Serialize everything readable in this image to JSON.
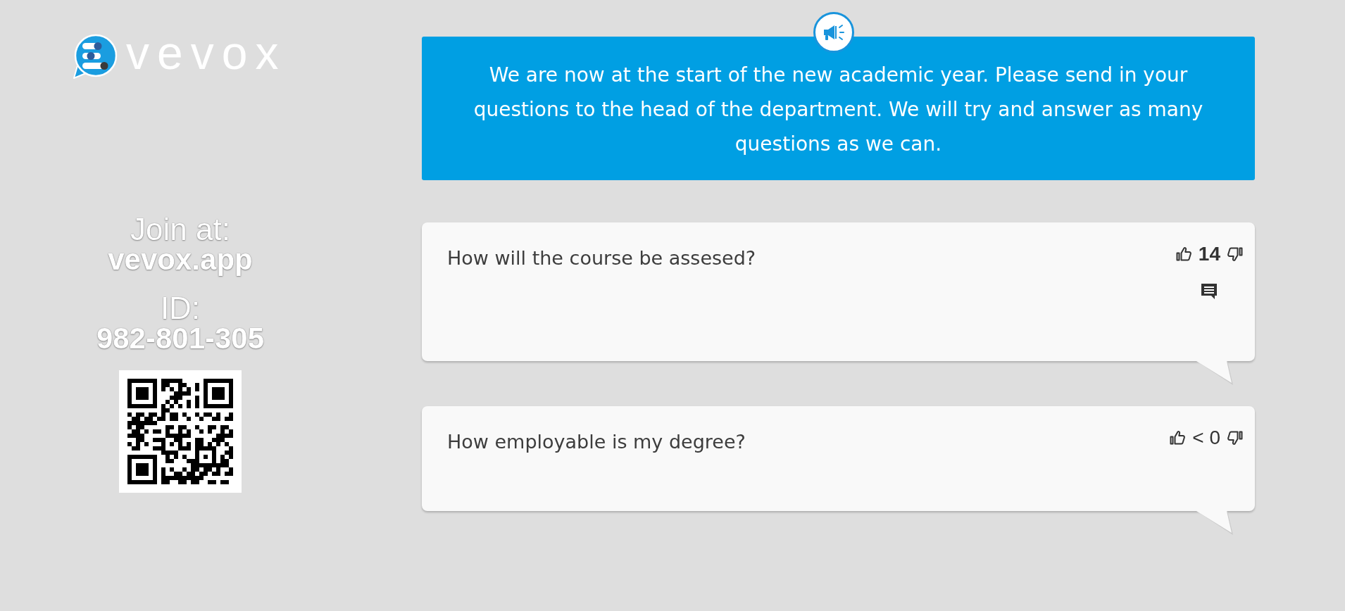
{
  "logo": {
    "wordmark": "vevox"
  },
  "join_panel": {
    "join_label": "Join at:",
    "join_url": "vevox.app",
    "id_label": "ID:",
    "event_id": "982-801-305"
  },
  "announcement": {
    "text": "We are now at the start of the new academic year. Please send in your questions to the head of the department. We will try and answer as many questions as we can."
  },
  "questions": [
    {
      "text": "How will the course be assesed?",
      "score": "14",
      "score_bold": true,
      "comments": true
    },
    {
      "text": "How employable is my degree?",
      "score": "< 0",
      "score_bold": false,
      "comments": false
    }
  ]
}
